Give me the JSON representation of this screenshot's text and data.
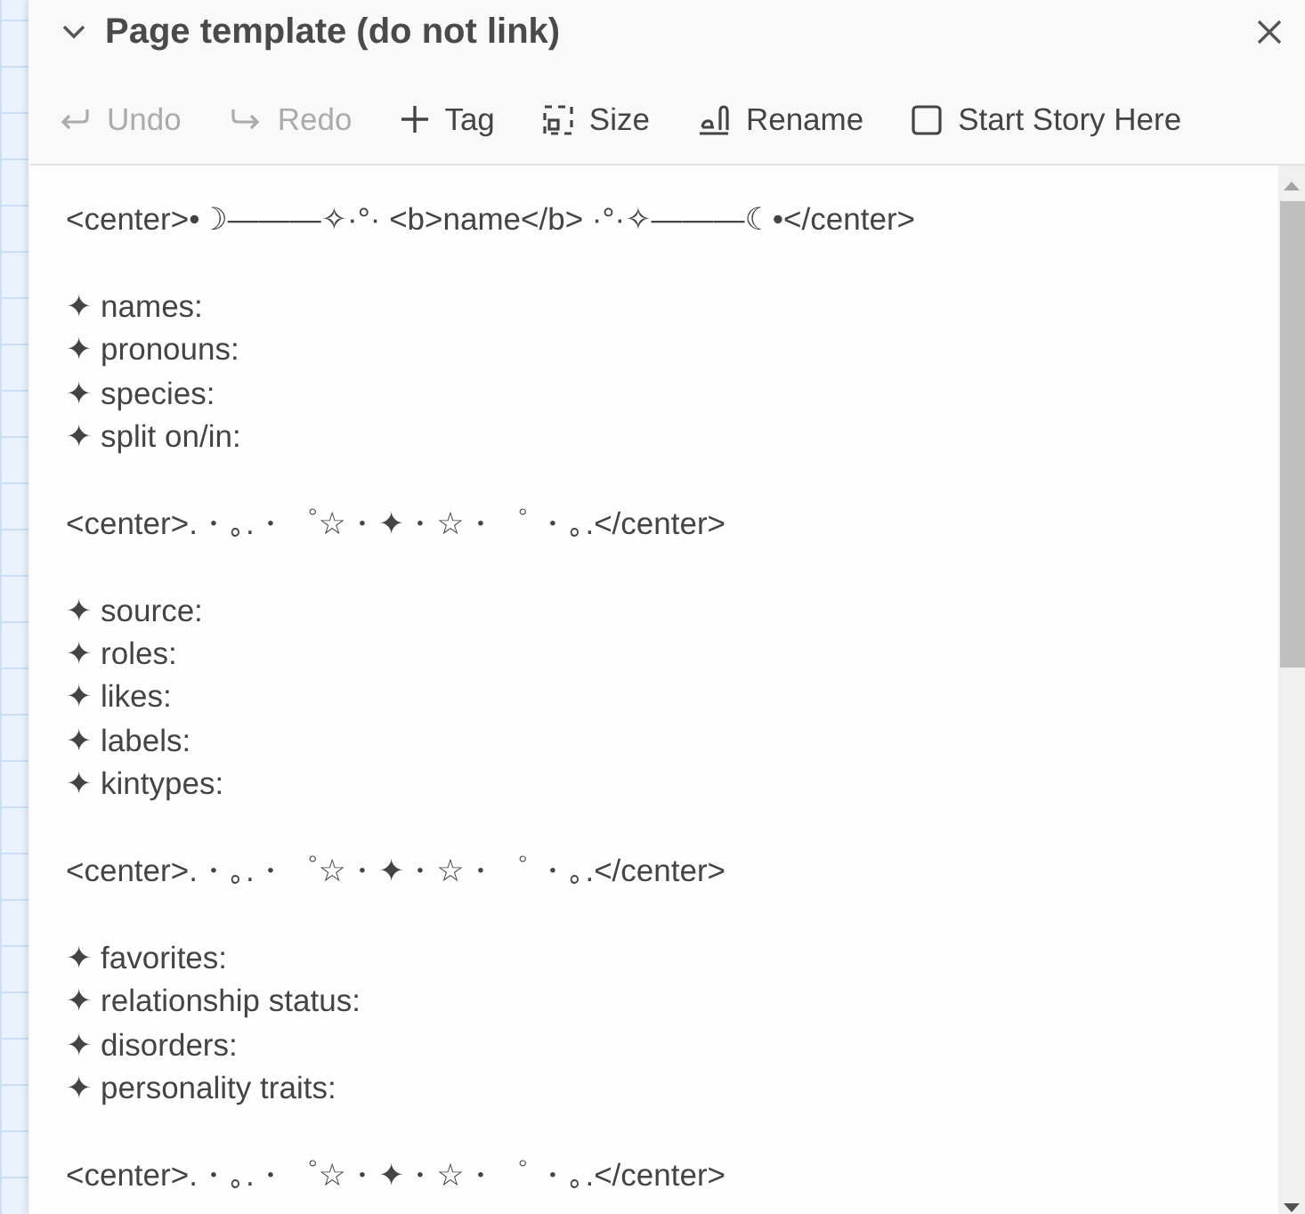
{
  "dialog": {
    "title": "Page template (do not link)",
    "expanded": true
  },
  "toolbar": [
    {
      "kind": "undo",
      "label": "Undo",
      "disabled": true
    },
    {
      "kind": "redo",
      "label": "Redo",
      "disabled": true
    },
    {
      "kind": "tag",
      "label": "Tag",
      "disabled": false
    },
    {
      "kind": "size",
      "label": "Size",
      "disabled": false
    },
    {
      "kind": "rename",
      "label": "Rename",
      "disabled": false
    },
    {
      "kind": "checkbox",
      "label": "Start Story Here",
      "checked": false
    }
  ],
  "editor": {
    "paragraphs": [
      [
        "<center>•☽———✧·°· <b>name</b> ·°·✧———☾•</center>"
      ],
      [
        "✦ names:",
        "✦ pronouns:",
        "✦ species:",
        "✦ split on/in:"
      ],
      [
        "<center>.・｡.・゜☆・✦・☆・゜ ・｡.</center>"
      ],
      [
        "✦ source:",
        "✦ roles:",
        "✦ likes:",
        "✦ labels:",
        "✦ kintypes:"
      ],
      [
        "<center>.・｡.・゜☆・✦・☆・゜ ・｡.</center>"
      ],
      [
        "✦ favorites:",
        "✦ relationship status:",
        "✦ disorders:",
        "✦ personality traits:"
      ],
      [
        "<center>.・｡.・゜☆・✦・☆・゜ ・｡.</center>"
      ]
    ]
  }
}
